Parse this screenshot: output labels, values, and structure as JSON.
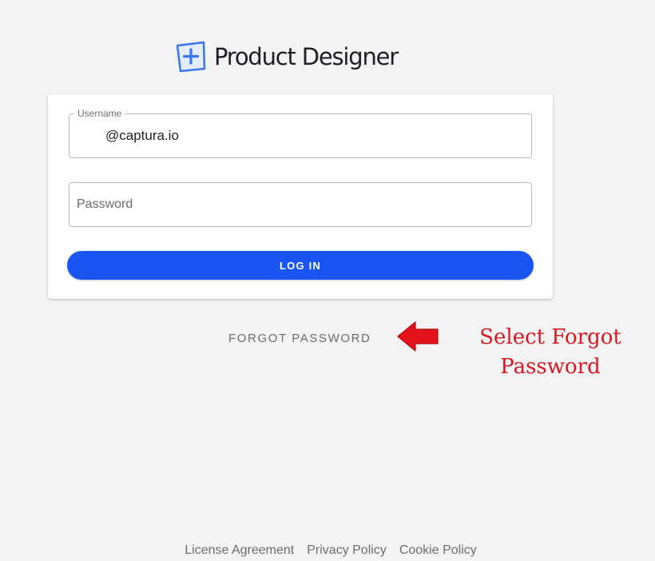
{
  "brand": {
    "name": "Product Designer",
    "logo_icon": "plus-square-icon",
    "accent_color": "#3b74ef"
  },
  "login_form": {
    "username": {
      "label": "Username",
      "value": "@captura.io"
    },
    "password": {
      "placeholder": "Password",
      "value": ""
    },
    "login_button_label": "LOG IN",
    "button_color": "#1954f5"
  },
  "forgot_password_label": "FORGOT PASSWORD",
  "annotation": {
    "line1": "Select Forgot",
    "line2": "Password",
    "arrow_icon": "left-arrow-icon",
    "color": "#d91820"
  },
  "footer": {
    "links": [
      "License Agreement",
      "Privacy Policy",
      "Cookie Policy"
    ]
  }
}
